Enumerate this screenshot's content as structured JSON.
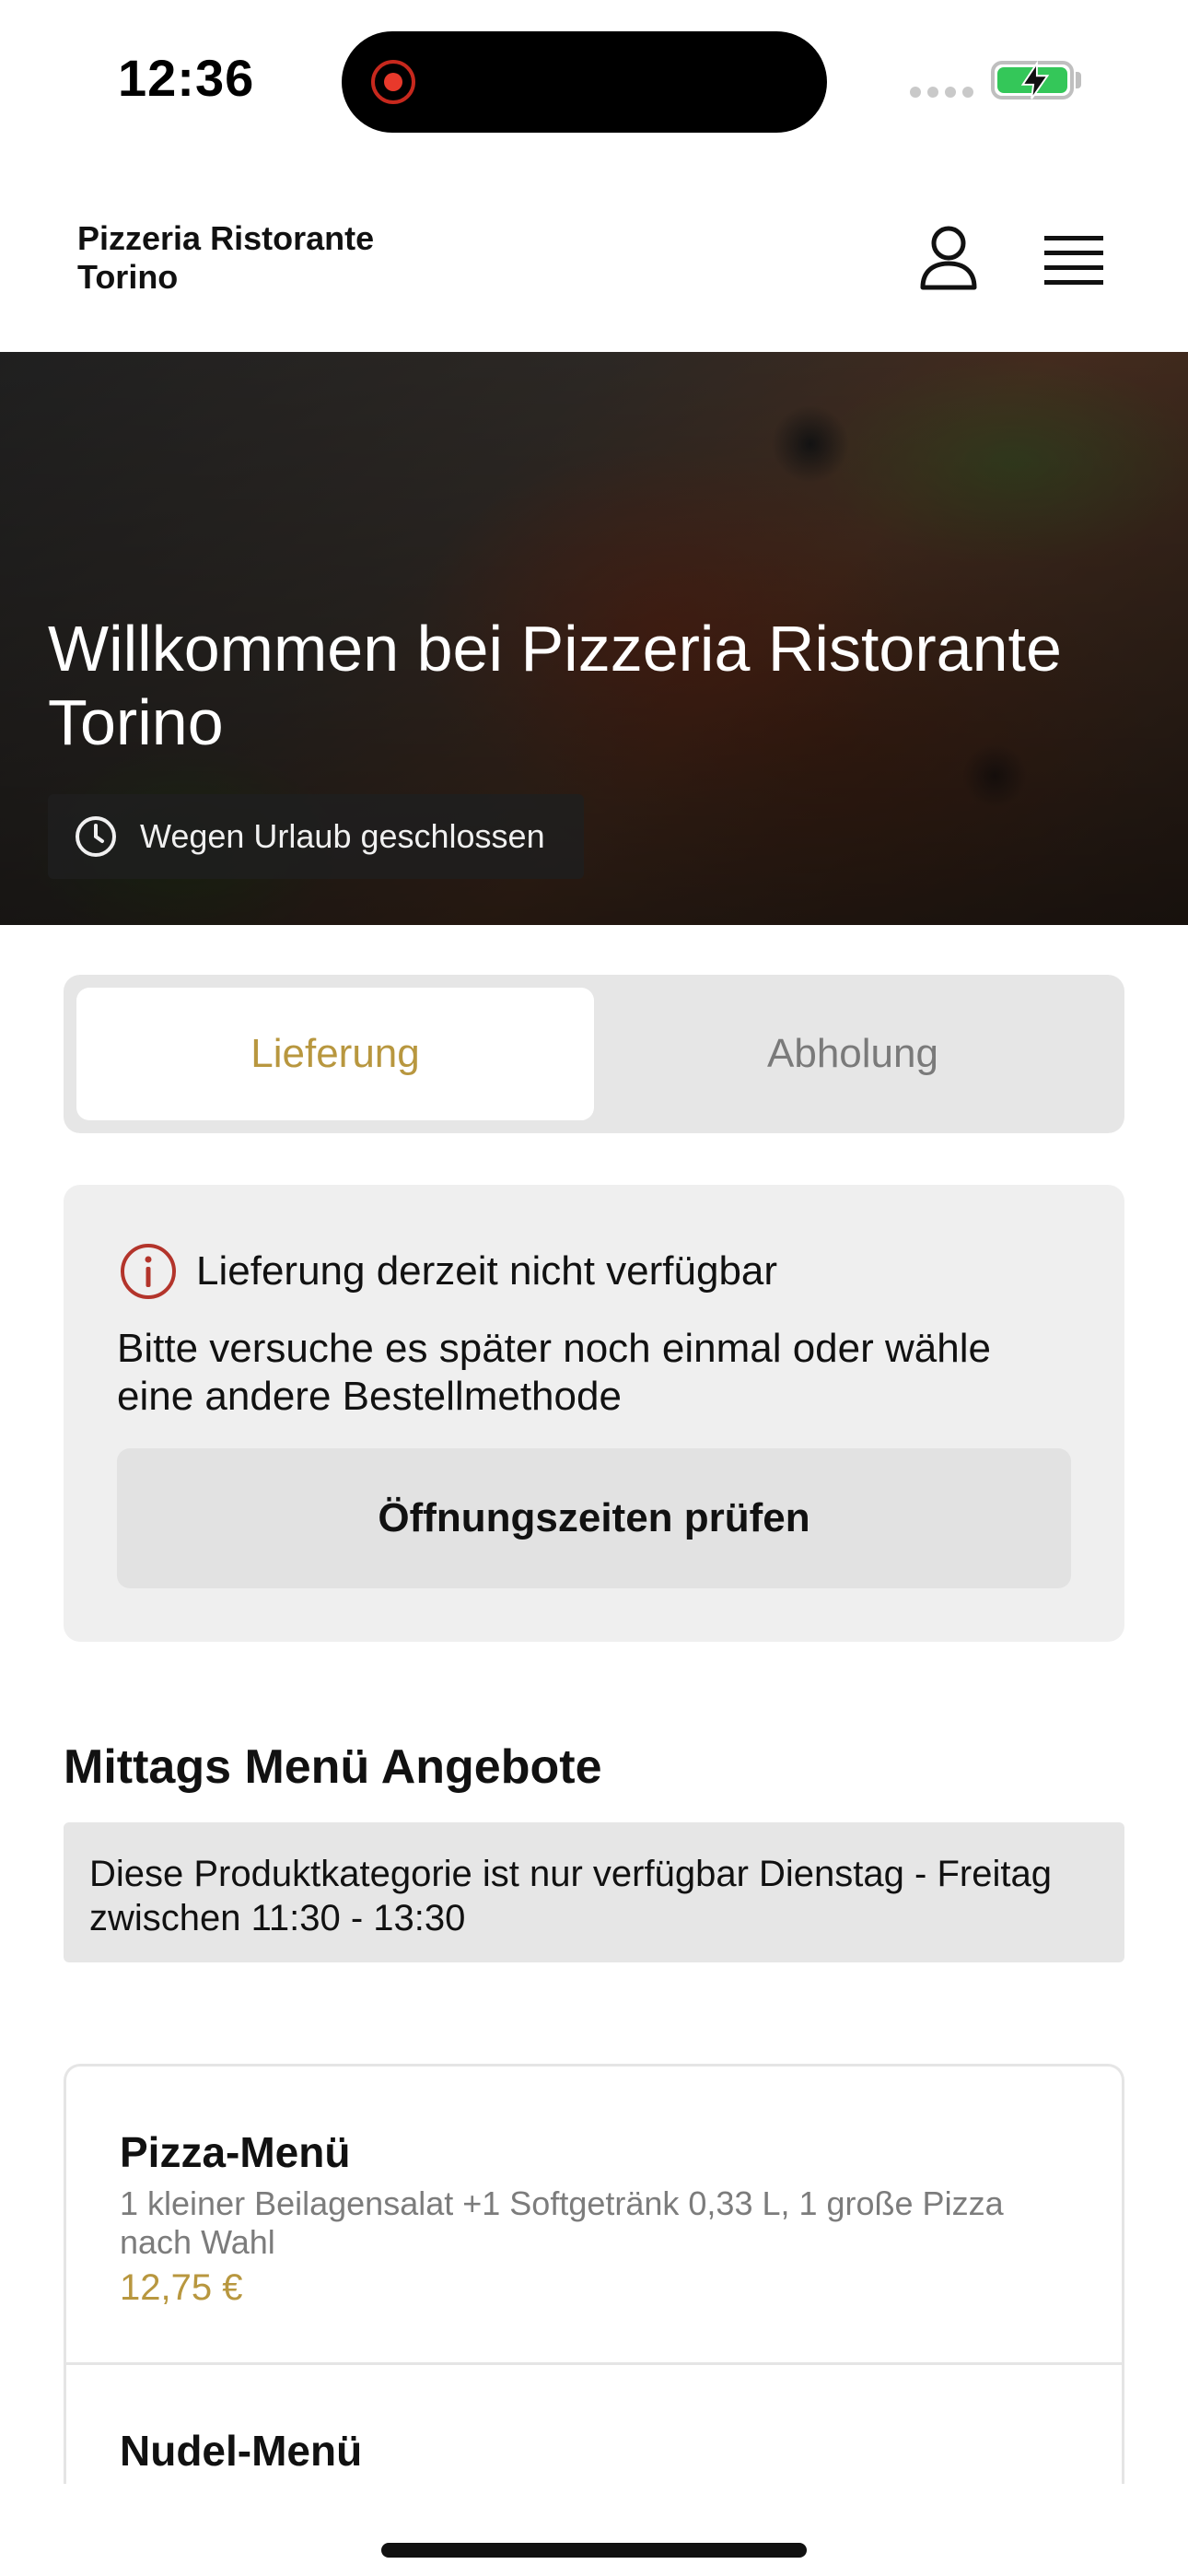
{
  "status_bar": {
    "time": "12:36"
  },
  "header": {
    "brand": "Pizzeria Ristorante Torino"
  },
  "hero": {
    "title": "Willkommen bei Pizzeria Ristorante Torino",
    "status_badge": "Wegen Urlaub geschlossen"
  },
  "order_mode": {
    "options": [
      {
        "label": "Lieferung",
        "selected": true
      },
      {
        "label": "Abholung",
        "selected": false
      }
    ]
  },
  "notice": {
    "title": "Lieferung derzeit nicht verfügbar",
    "body": "Bitte versuche es später noch einmal oder wähle eine andere Bestellmethode",
    "button_label": "Öffnungszeiten prüfen"
  },
  "section": {
    "title": "Mittags Menü Angebote",
    "availability_note": "Diese Produktkategorie ist nur verfügbar Dienstag - Freitag zwischen 11:30 - 13:30"
  },
  "products": [
    {
      "name": "Pizza-Menü",
      "description": "1 kleiner Beilagensalat +1 Softgetränk 0,33 L, 1 große Pizza nach Wahl",
      "price": "12,75 €"
    },
    {
      "name": "Nudel-Menü",
      "description": "",
      "price": ""
    }
  ],
  "colors": {
    "accent": "#b8973f",
    "alert": "#b3342b",
    "battery": "#34c759"
  }
}
